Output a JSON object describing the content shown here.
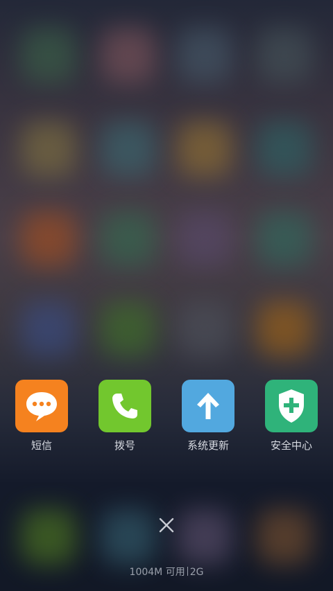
{
  "recent_apps": [
    {
      "label": "短信",
      "icon": "message-bubble-icon",
      "color": "#f5821f"
    },
    {
      "label": "拨号",
      "icon": "phone-icon",
      "color": "#72c72e"
    },
    {
      "label": "系统更新",
      "icon": "upload-arrow-icon",
      "color": "#52a8df"
    },
    {
      "label": "安全中心",
      "icon": "shield-plus-icon",
      "color": "#2fb37a"
    }
  ],
  "close_button": {
    "icon": "close-icon"
  },
  "memory": {
    "available": "1004M 可用",
    "ram": "2G"
  }
}
